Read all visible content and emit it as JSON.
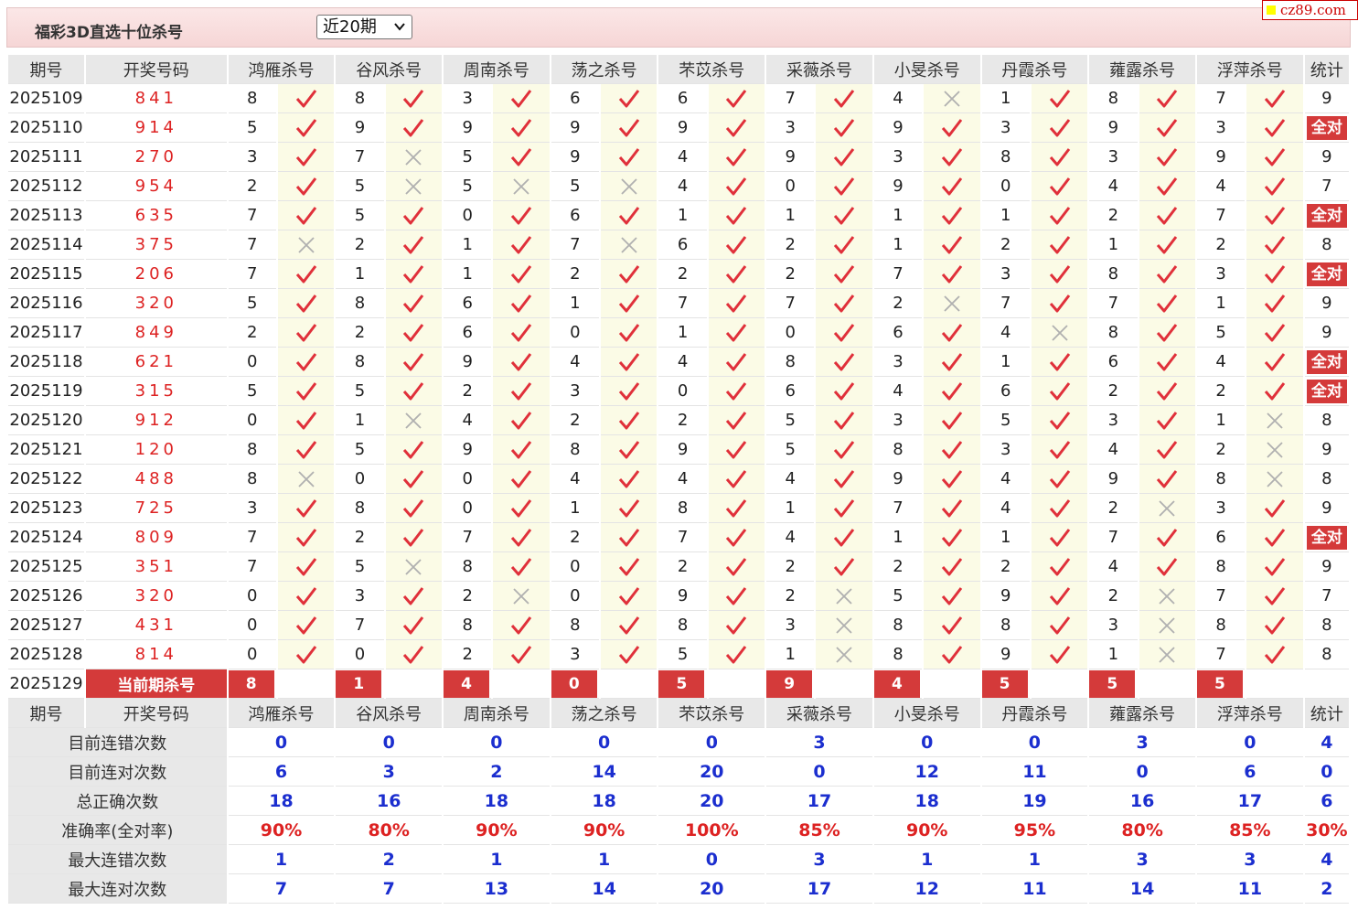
{
  "header": {
    "title": "福彩3D直选十位杀号",
    "period_select": "近20期"
  },
  "logo": "cz89.com",
  "columns": {
    "period": "期号",
    "draw": "开奖号码",
    "experts": [
      "鸿雁杀号",
      "谷风杀号",
      "周南杀号",
      "荡之杀号",
      "芣苡杀号",
      "采薇杀号",
      "小旻杀号",
      "丹霞杀号",
      "蕹露杀号",
      "浮萍杀号"
    ],
    "stat": "统计"
  },
  "all_correct_label": "全对",
  "rows": [
    {
      "period": "2025109",
      "draw": "841",
      "picks": [
        8,
        8,
        3,
        6,
        6,
        7,
        4,
        1,
        8,
        7
      ],
      "ok": [
        1,
        1,
        1,
        1,
        1,
        1,
        0,
        1,
        1,
        1
      ],
      "stat": "9"
    },
    {
      "period": "2025110",
      "draw": "914",
      "picks": [
        5,
        9,
        9,
        9,
        9,
        3,
        9,
        3,
        9,
        3
      ],
      "ok": [
        1,
        1,
        1,
        1,
        1,
        1,
        1,
        1,
        1,
        1
      ],
      "stat": "全对"
    },
    {
      "period": "2025111",
      "draw": "270",
      "picks": [
        3,
        7,
        5,
        9,
        4,
        9,
        3,
        8,
        3,
        9
      ],
      "ok": [
        1,
        0,
        1,
        1,
        1,
        1,
        1,
        1,
        1,
        1
      ],
      "stat": "9"
    },
    {
      "period": "2025112",
      "draw": "954",
      "picks": [
        2,
        5,
        5,
        5,
        4,
        0,
        9,
        0,
        4,
        4
      ],
      "ok": [
        1,
        0,
        0,
        0,
        1,
        1,
        1,
        1,
        1,
        1
      ],
      "stat": "7"
    },
    {
      "period": "2025113",
      "draw": "635",
      "picks": [
        7,
        5,
        0,
        6,
        1,
        1,
        1,
        1,
        2,
        7
      ],
      "ok": [
        1,
        1,
        1,
        1,
        1,
        1,
        1,
        1,
        1,
        1
      ],
      "stat": "全对"
    },
    {
      "period": "2025114",
      "draw": "375",
      "picks": [
        7,
        2,
        1,
        7,
        6,
        2,
        1,
        2,
        1,
        2
      ],
      "ok": [
        0,
        1,
        1,
        0,
        1,
        1,
        1,
        1,
        1,
        1
      ],
      "stat": "8"
    },
    {
      "period": "2025115",
      "draw": "206",
      "picks": [
        7,
        1,
        1,
        2,
        2,
        2,
        7,
        3,
        8,
        3
      ],
      "ok": [
        1,
        1,
        1,
        1,
        1,
        1,
        1,
        1,
        1,
        1
      ],
      "stat": "全对"
    },
    {
      "period": "2025116",
      "draw": "320",
      "picks": [
        5,
        8,
        6,
        1,
        7,
        7,
        2,
        7,
        7,
        1
      ],
      "ok": [
        1,
        1,
        1,
        1,
        1,
        1,
        0,
        1,
        1,
        1
      ],
      "stat": "9"
    },
    {
      "period": "2025117",
      "draw": "849",
      "picks": [
        2,
        2,
        6,
        0,
        1,
        0,
        6,
        4,
        8,
        5
      ],
      "ok": [
        1,
        1,
        1,
        1,
        1,
        1,
        1,
        0,
        1,
        1
      ],
      "stat": "9"
    },
    {
      "period": "2025118",
      "draw": "621",
      "picks": [
        0,
        8,
        9,
        4,
        4,
        8,
        3,
        1,
        6,
        4
      ],
      "ok": [
        1,
        1,
        1,
        1,
        1,
        1,
        1,
        1,
        1,
        1
      ],
      "stat": "全对"
    },
    {
      "period": "2025119",
      "draw": "315",
      "picks": [
        5,
        5,
        2,
        3,
        0,
        6,
        4,
        6,
        2,
        2
      ],
      "ok": [
        1,
        1,
        1,
        1,
        1,
        1,
        1,
        1,
        1,
        1
      ],
      "stat": "全对"
    },
    {
      "period": "2025120",
      "draw": "912",
      "picks": [
        0,
        1,
        4,
        2,
        2,
        5,
        3,
        5,
        3,
        1
      ],
      "ok": [
        1,
        0,
        1,
        1,
        1,
        1,
        1,
        1,
        1,
        0
      ],
      "stat": "8"
    },
    {
      "period": "2025121",
      "draw": "120",
      "picks": [
        8,
        5,
        9,
        8,
        9,
        5,
        8,
        3,
        4,
        2
      ],
      "ok": [
        1,
        1,
        1,
        1,
        1,
        1,
        1,
        1,
        1,
        0
      ],
      "stat": "9"
    },
    {
      "period": "2025122",
      "draw": "488",
      "picks": [
        8,
        0,
        0,
        4,
        4,
        4,
        9,
        4,
        9,
        8
      ],
      "ok": [
        0,
        1,
        1,
        1,
        1,
        1,
        1,
        1,
        1,
        0
      ],
      "stat": "8"
    },
    {
      "period": "2025123",
      "draw": "725",
      "picks": [
        3,
        8,
        0,
        1,
        8,
        1,
        7,
        4,
        2,
        3
      ],
      "ok": [
        1,
        1,
        1,
        1,
        1,
        1,
        1,
        1,
        0,
        1
      ],
      "stat": "9"
    },
    {
      "period": "2025124",
      "draw": "809",
      "picks": [
        7,
        2,
        7,
        2,
        7,
        4,
        1,
        1,
        7,
        6
      ],
      "ok": [
        1,
        1,
        1,
        1,
        1,
        1,
        1,
        1,
        1,
        1
      ],
      "stat": "全对"
    },
    {
      "period": "2025125",
      "draw": "351",
      "picks": [
        7,
        5,
        8,
        0,
        2,
        2,
        2,
        2,
        4,
        8
      ],
      "ok": [
        1,
        0,
        1,
        1,
        1,
        1,
        1,
        1,
        1,
        1
      ],
      "stat": "9"
    },
    {
      "period": "2025126",
      "draw": "320",
      "picks": [
        0,
        3,
        2,
        0,
        9,
        2,
        5,
        9,
        2,
        7
      ],
      "ok": [
        1,
        1,
        0,
        1,
        1,
        0,
        1,
        1,
        0,
        1
      ],
      "stat": "7"
    },
    {
      "period": "2025127",
      "draw": "431",
      "picks": [
        0,
        7,
        8,
        8,
        8,
        3,
        8,
        8,
        3,
        8
      ],
      "ok": [
        1,
        1,
        1,
        1,
        1,
        0,
        1,
        1,
        0,
        1
      ],
      "stat": "8"
    },
    {
      "period": "2025128",
      "draw": "814",
      "picks": [
        0,
        0,
        2,
        3,
        5,
        1,
        8,
        9,
        1,
        7
      ],
      "ok": [
        1,
        1,
        1,
        1,
        1,
        0,
        1,
        1,
        0,
        1
      ],
      "stat": "8"
    }
  ],
  "current": {
    "period": "2025129",
    "label": "当前期杀号",
    "picks": [
      8,
      1,
      4,
      0,
      5,
      9,
      4,
      5,
      5,
      5
    ]
  },
  "summary": [
    {
      "label": "目前连错次数",
      "values": [
        "0",
        "0",
        "0",
        "0",
        "0",
        "3",
        "0",
        "0",
        "3",
        "0"
      ],
      "stat": "4",
      "rate": false
    },
    {
      "label": "目前连对次数",
      "values": [
        "6",
        "3",
        "2",
        "14",
        "20",
        "0",
        "12",
        "11",
        "0",
        "6"
      ],
      "stat": "0",
      "rate": false
    },
    {
      "label": "总正确次数",
      "values": [
        "18",
        "16",
        "18",
        "18",
        "20",
        "17",
        "18",
        "19",
        "16",
        "17"
      ],
      "stat": "6",
      "rate": false
    },
    {
      "label": "准确率(全对率)",
      "values": [
        "90%",
        "80%",
        "90%",
        "90%",
        "100%",
        "85%",
        "90%",
        "95%",
        "80%",
        "85%"
      ],
      "stat": "30%",
      "rate": true
    },
    {
      "label": "最大连错次数",
      "values": [
        "1",
        "2",
        "1",
        "1",
        "0",
        "3",
        "1",
        "1",
        "3",
        "3"
      ],
      "stat": "4",
      "rate": false
    },
    {
      "label": "最大连对次数",
      "values": [
        "7",
        "7",
        "13",
        "14",
        "20",
        "17",
        "12",
        "11",
        "14",
        "11"
      ],
      "stat": "2",
      "rate": false
    }
  ],
  "colors": {
    "accent_red": "#d43a3a",
    "check": "#e0303a",
    "cross": "#b0b0b0",
    "summary_blue": "#1b2ecf"
  },
  "icons": {
    "ok": "check-icon",
    "miss": "cross-icon"
  }
}
